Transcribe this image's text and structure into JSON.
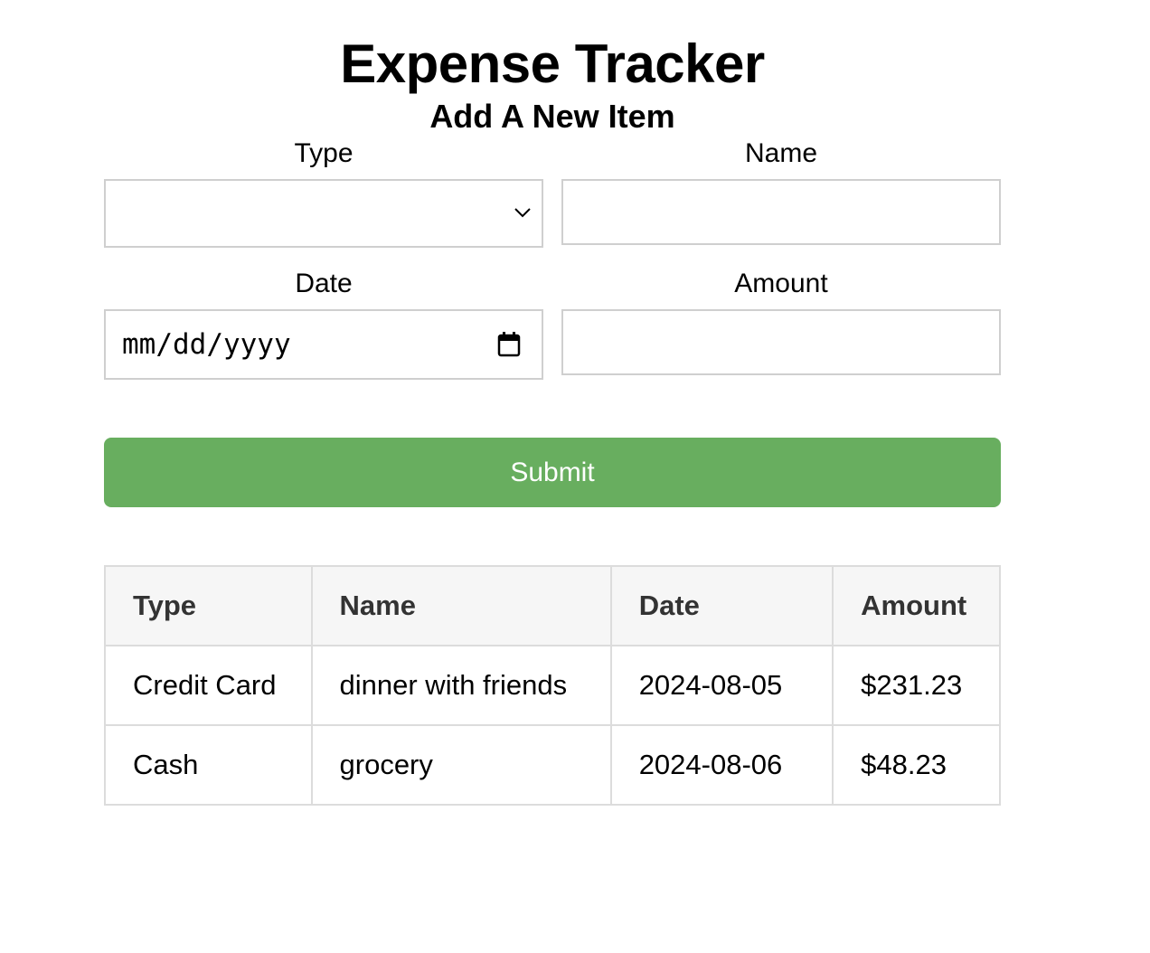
{
  "header": {
    "title": "Expense Tracker",
    "subtitle": "Add A New Item"
  },
  "form": {
    "type_label": "Type",
    "type_value": "",
    "name_label": "Name",
    "name_value": "",
    "date_label": "Date",
    "date_placeholder": "mm/dd/yyyy",
    "amount_label": "Amount",
    "amount_value": "",
    "submit_label": "Submit",
    "submit_color": "#68ae5f"
  },
  "table": {
    "headers": [
      "Type",
      "Name",
      "Date",
      "Amount"
    ],
    "rows": [
      [
        "Credit Card",
        "dinner with friends",
        "2024-08-05",
        "$231.23"
      ],
      [
        "Cash",
        "grocery",
        "2024-08-06",
        "$48.23"
      ]
    ]
  },
  "icons": {
    "select_chevron": "chevron-down-icon",
    "date_picker": "calendar-icon"
  }
}
